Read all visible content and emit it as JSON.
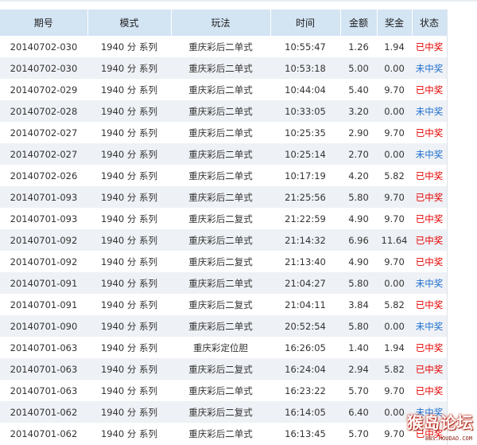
{
  "table": {
    "columns": [
      "期号",
      "模式",
      "玩法",
      "时间",
      "金额",
      "奖金",
      "状态"
    ],
    "rows": [
      {
        "period": "20140702-030",
        "mode": "1940 分 系列",
        "play": "重庆彩后二单式",
        "time": "10:55:47",
        "amount": "1.26",
        "prize": "1.94",
        "status": "已中奖",
        "won": true
      },
      {
        "period": "20140702-030",
        "mode": "1940 分 系列",
        "play": "重庆彩后二单式",
        "time": "10:53:18",
        "amount": "5.00",
        "prize": "0.00",
        "status": "未中奖",
        "won": false
      },
      {
        "period": "20140702-029",
        "mode": "1940 分 系列",
        "play": "重庆彩后二单式",
        "time": "10:44:04",
        "amount": "5.40",
        "prize": "9.70",
        "status": "已中奖",
        "won": true
      },
      {
        "period": "20140702-028",
        "mode": "1940 分 系列",
        "play": "重庆彩后二单式",
        "time": "10:33:05",
        "amount": "3.20",
        "prize": "0.00",
        "status": "未中奖",
        "won": false
      },
      {
        "period": "20140702-027",
        "mode": "1940 分 系列",
        "play": "重庆彩后二单式",
        "time": "10:25:35",
        "amount": "2.90",
        "prize": "9.70",
        "status": "已中奖",
        "won": true
      },
      {
        "period": "20140702-027",
        "mode": "1940 分 系列",
        "play": "重庆彩后二单式",
        "time": "10:25:14",
        "amount": "2.70",
        "prize": "0.00",
        "status": "未中奖",
        "won": false
      },
      {
        "period": "20140702-026",
        "mode": "1940 分 系列",
        "play": "重庆彩后二单式",
        "time": "10:17:19",
        "amount": "4.20",
        "prize": "5.82",
        "status": "已中奖",
        "won": true
      },
      {
        "period": "20140701-093",
        "mode": "1940 分 系列",
        "play": "重庆彩后二单式",
        "time": "21:25:56",
        "amount": "5.80",
        "prize": "9.70",
        "status": "已中奖",
        "won": true
      },
      {
        "period": "20140701-093",
        "mode": "1940 分 系列",
        "play": "重庆彩后二复式",
        "time": "21:22:59",
        "amount": "4.90",
        "prize": "9.70",
        "status": "已中奖",
        "won": true
      },
      {
        "period": "20140701-092",
        "mode": "1940 分 系列",
        "play": "重庆彩后二单式",
        "time": "21:14:32",
        "amount": "6.96",
        "prize": "11.64",
        "status": "已中奖",
        "won": true
      },
      {
        "period": "20140701-092",
        "mode": "1940 分 系列",
        "play": "重庆彩后二复式",
        "time": "21:13:40",
        "amount": "4.90",
        "prize": "9.70",
        "status": "已中奖",
        "won": true
      },
      {
        "period": "20140701-091",
        "mode": "1940 分 系列",
        "play": "重庆彩后二单式",
        "time": "21:04:27",
        "amount": "5.80",
        "prize": "0.00",
        "status": "未中奖",
        "won": false
      },
      {
        "period": "20140701-091",
        "mode": "1940 分 系列",
        "play": "重庆彩后二复式",
        "time": "21:04:11",
        "amount": "3.84",
        "prize": "5.82",
        "status": "已中奖",
        "won": true
      },
      {
        "period": "20140701-090",
        "mode": "1940 分 系列",
        "play": "重庆彩后二单式",
        "time": "20:52:54",
        "amount": "5.80",
        "prize": "0.00",
        "status": "未中奖",
        "won": false
      },
      {
        "period": "20140701-063",
        "mode": "1940 分 系列",
        "play": "重庆彩定位胆",
        "time": "16:26:05",
        "amount": "1.40",
        "prize": "1.94",
        "status": "已中奖",
        "won": true
      },
      {
        "period": "20140701-063",
        "mode": "1940 分 系列",
        "play": "重庆彩后二复式",
        "time": "16:24:04",
        "amount": "2.94",
        "prize": "5.82",
        "status": "已中奖",
        "won": true
      },
      {
        "period": "20140701-063",
        "mode": "1940 分 系列",
        "play": "重庆彩后二单式",
        "time": "16:23:22",
        "amount": "5.70",
        "prize": "9.70",
        "status": "已中奖",
        "won": true
      },
      {
        "period": "20140701-062",
        "mode": "1940 分 系列",
        "play": "重庆彩后二复式",
        "time": "16:14:05",
        "amount": "6.40",
        "prize": "0.00",
        "status": "未中奖",
        "won": false
      },
      {
        "period": "20140701-062",
        "mode": "1940 分 系列",
        "play": "重庆彩后二单式",
        "time": "16:13:45",
        "amount": "5.70",
        "prize": "9.70",
        "status": "已中奖",
        "won": true
      }
    ]
  },
  "colors": {
    "header_bg": "#d3e4f3",
    "row_alt_bg": "#eef1f5",
    "status_won": "#e60000",
    "status_lost": "#1f6fcf"
  },
  "watermark": {
    "title": "猴岛论坛",
    "url": "BBS.HOUDAO.COM"
  }
}
